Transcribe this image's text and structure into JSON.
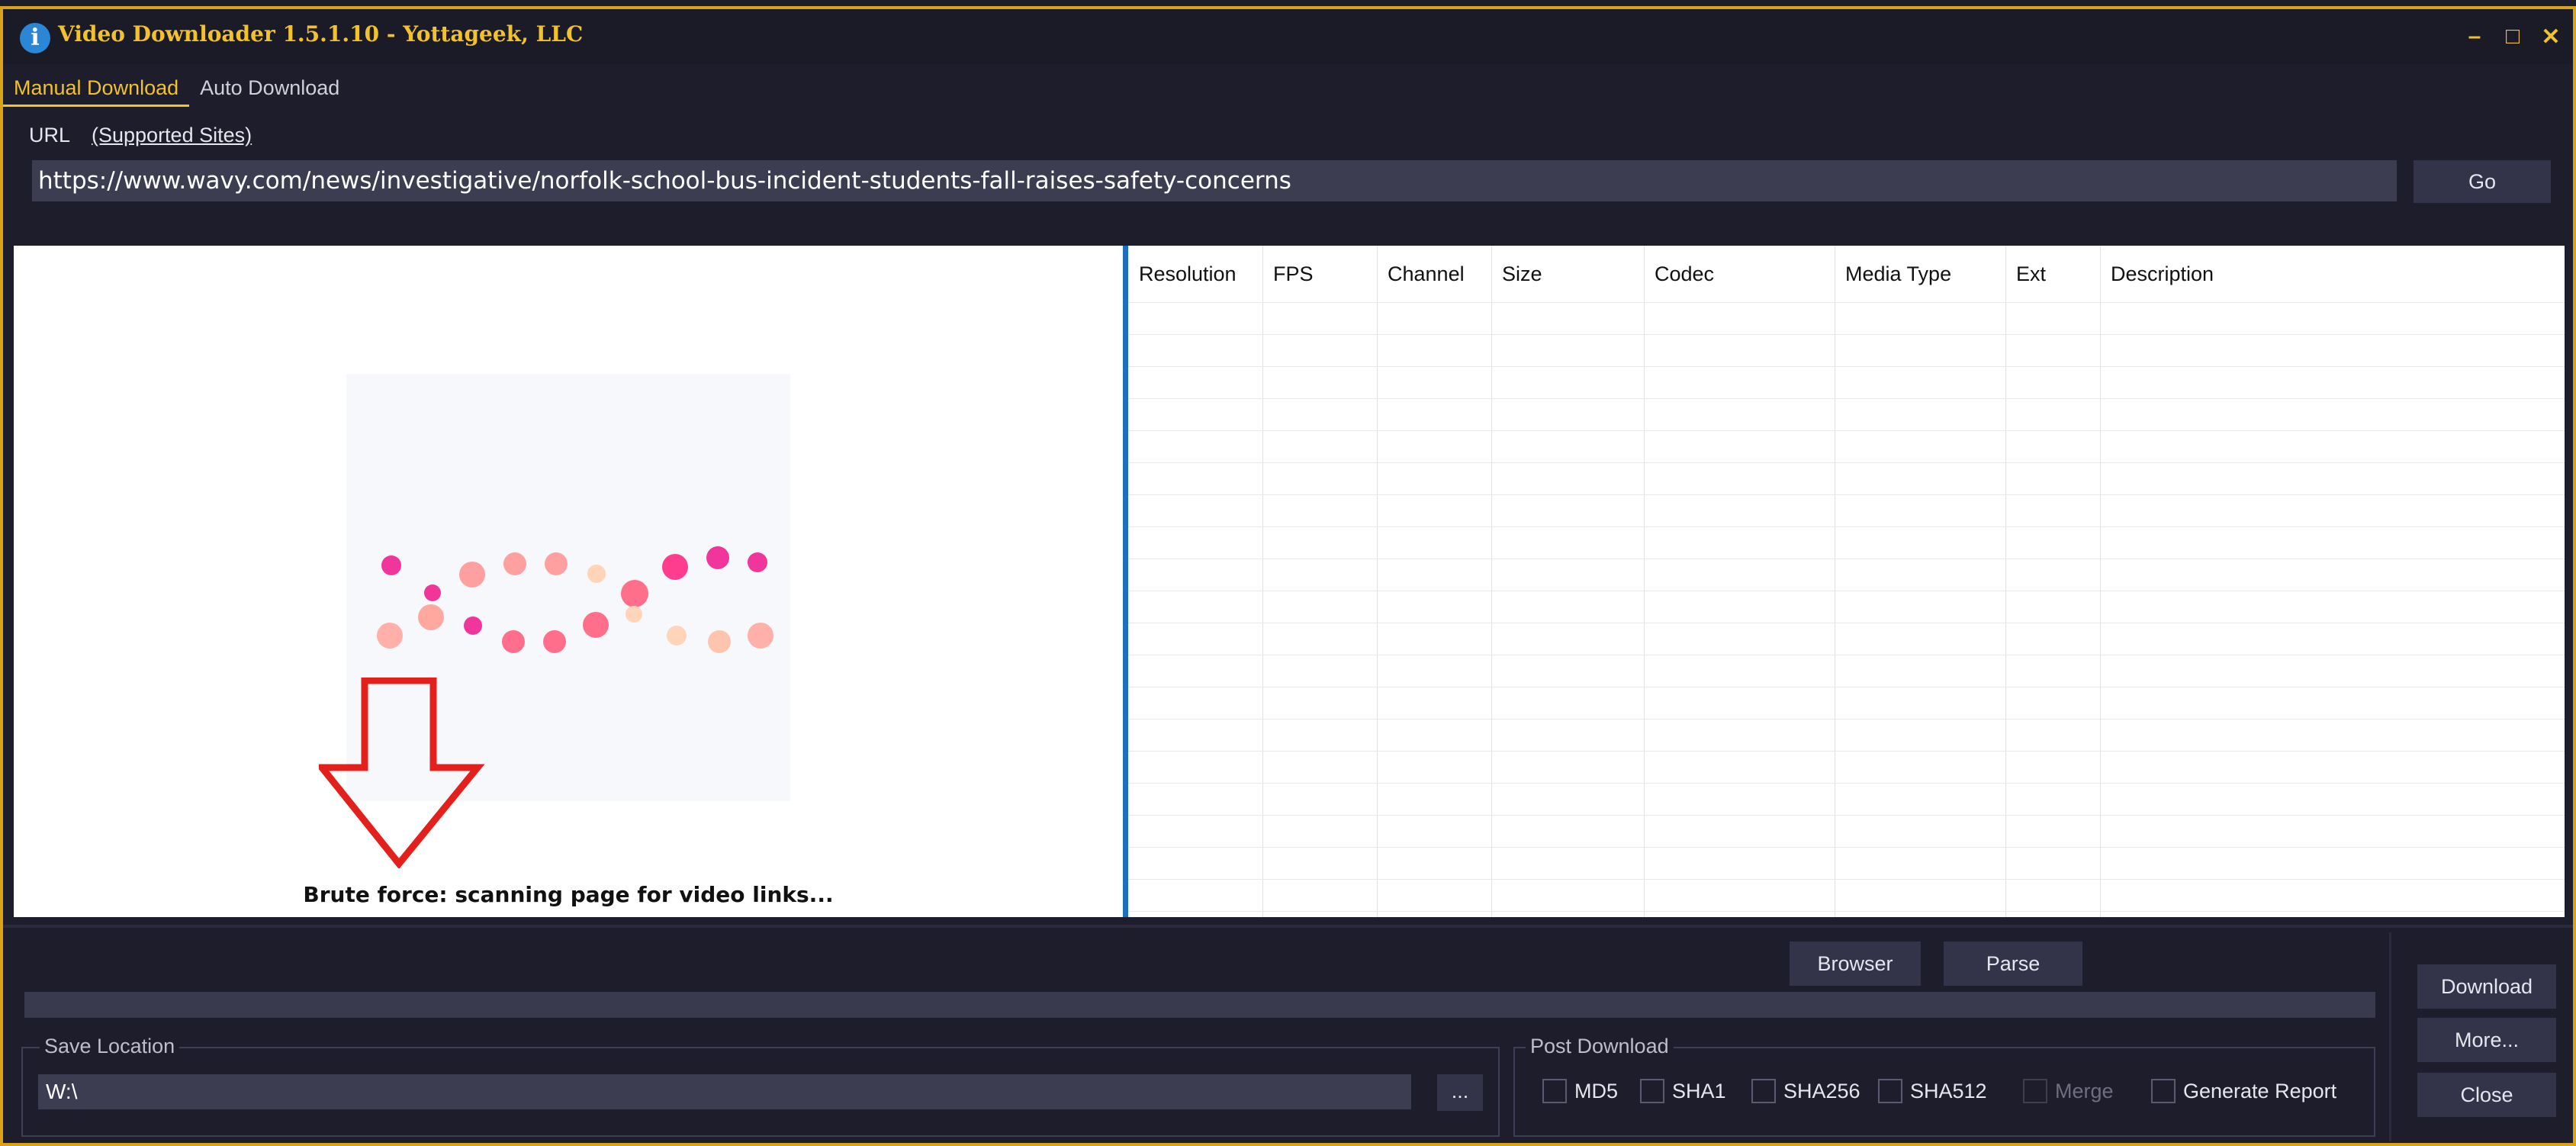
{
  "window": {
    "title": "Video Downloader 1.5.1.10 - Yottageek, LLC",
    "accent_color": "#f2c12e",
    "controls": [
      "–",
      "□",
      "✕"
    ]
  },
  "tabs": [
    {
      "label": "Manual Download",
      "active": true
    },
    {
      "label": "Auto Download",
      "active": false
    }
  ],
  "url": {
    "label": "URL",
    "supported_link": "(Supported Sites)",
    "value": "https://www.wavy.com/news/investigative/norfolk-school-bus-incident-students-fall-raises-safety-concerns",
    "go_label": "Go"
  },
  "preview": {
    "status_text": "Brute force: scanning page for video links...",
    "loader_icon": "dots-spinner-icon",
    "annotation_icon": "red-down-arrow-icon"
  },
  "table": {
    "columns": [
      "Resolution",
      "FPS",
      "Channel",
      "Size",
      "Codec",
      "Media Type",
      "Ext",
      "Description"
    ],
    "rows": []
  },
  "actions": {
    "browser_label": "Browser",
    "parse_label": "Parse",
    "download_label": "Download",
    "more_label": "More...",
    "close_label": "Close"
  },
  "save": {
    "legend": "Save Location",
    "path": "W:\\",
    "browse_label": "..."
  },
  "post_download": {
    "legend": "Post Download",
    "options": [
      {
        "label": "MD5",
        "checked": false,
        "enabled": true
      },
      {
        "label": "SHA1",
        "checked": false,
        "enabled": true
      },
      {
        "label": "SHA256",
        "checked": false,
        "enabled": true
      },
      {
        "label": "SHA512",
        "checked": false,
        "enabled": true
      },
      {
        "label": "Merge",
        "checked": false,
        "enabled": false
      },
      {
        "label": "Generate Report",
        "checked": false,
        "enabled": true
      }
    ]
  }
}
